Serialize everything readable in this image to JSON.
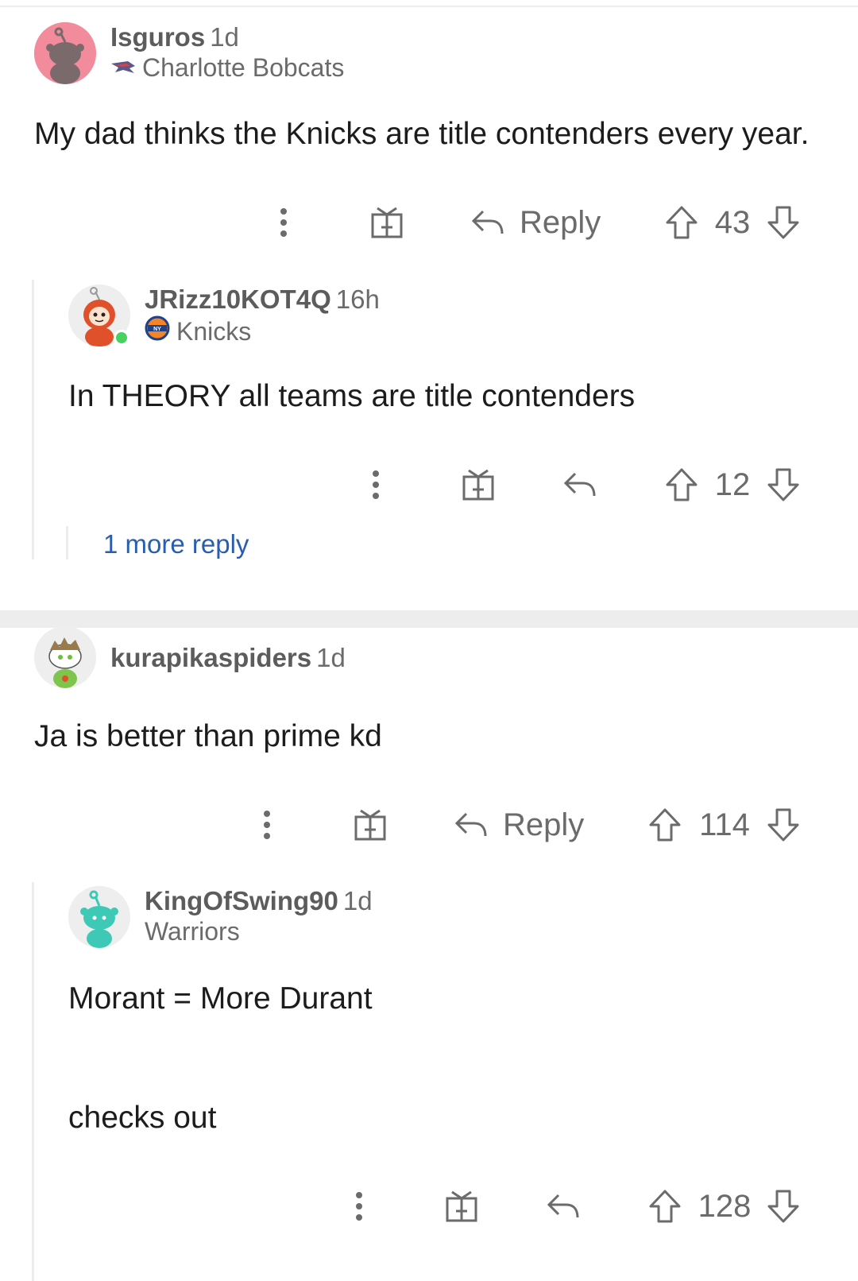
{
  "comments": [
    {
      "username": "Isguros",
      "age": "1d",
      "flair": "Charlotte Bobcats",
      "body": "My dad thinks the Knicks are title contenders every year.",
      "reply_label": "Reply",
      "votes": "43",
      "avatar_color": "#f28b9b"
    },
    {
      "username": "JRizz10KOT4Q",
      "age": "16h",
      "flair": "Knicks",
      "body": "In THEORY all teams are title contenders",
      "votes": "12",
      "more_replies": "1 more reply",
      "online": true
    },
    {
      "username": "kurapikaspiders",
      "age": "1d",
      "body": "Ja is better than prime kd",
      "reply_label": "Reply",
      "votes": "114"
    },
    {
      "username": "KingOfSwing90",
      "age": "1d",
      "flair": "Warriors",
      "body_line1": "Morant = More Durant",
      "body_line2": "checks out",
      "votes": "128",
      "avatar_color": "#3ec9b6"
    }
  ],
  "icons": {
    "overflow": "more-vertical-icon",
    "award": "gift-icon",
    "reply": "reply-arrow-icon",
    "upvote": "upvote-arrow-icon",
    "downvote": "downvote-arrow-icon"
  },
  "colors": {
    "link": "#2a5db0",
    "meta": "#6b6b6b",
    "online": "#46d160"
  }
}
